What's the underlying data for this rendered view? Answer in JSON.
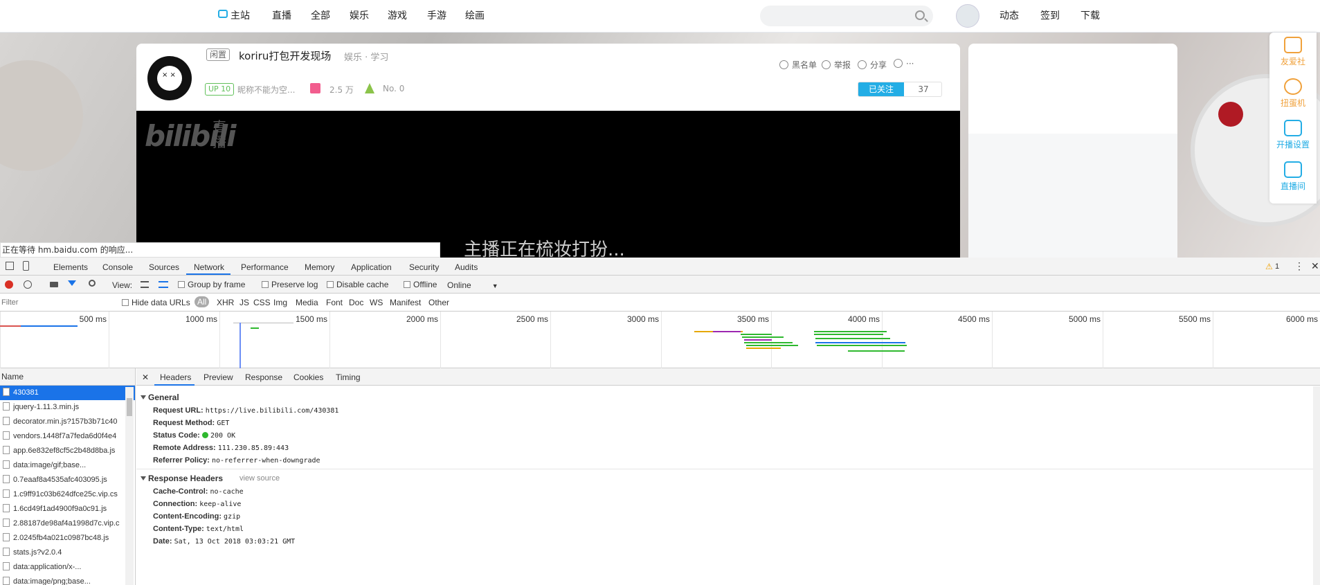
{
  "site_nav": {
    "links": [
      "主站",
      "直播",
      "全部",
      "娱乐",
      "游戏",
      "手游",
      "绘画"
    ],
    "right_links": [
      "动态",
      "签到",
      "下载"
    ]
  },
  "room": {
    "tag_status": "闲置",
    "title": "koriru打包开发现场",
    "category": "娱乐 · 学习",
    "up_level": "UP 10",
    "streamer": "昵称不能为空...",
    "gift_count": "2.5 万",
    "rank": "No. 0",
    "actions": [
      "黑名单",
      "举报",
      "分享",
      "···"
    ],
    "follow_label": "已关注",
    "follow_count": "37",
    "logo_text": "bilibili",
    "logo_sub": "直播",
    "video_message": "主播正在梳妆打扮..."
  },
  "right_bar": [
    "友爱社",
    "扭蛋机",
    "开播设置",
    "直播间"
  ],
  "status_text": "正在等待 hm.baidu.com 的响应...",
  "devtools": {
    "tabs": [
      "Elements",
      "Console",
      "Sources",
      "Network",
      "Performance",
      "Memory",
      "Application",
      "Security",
      "Audits"
    ],
    "active_tab": "Network",
    "warning_count": "1",
    "toolbar": {
      "view_label": "View:",
      "group_by_frame": "Group by frame",
      "preserve_log": "Preserve log",
      "disable_cache": "Disable cache",
      "offline": "Offline",
      "throttle": "Online"
    },
    "filter": {
      "placeholder": "Filter",
      "hide_data_urls": "Hide data URLs",
      "types": [
        "All",
        "XHR",
        "JS",
        "CSS",
        "Img",
        "Media",
        "Font",
        "Doc",
        "WS",
        "Manifest",
        "Other"
      ]
    },
    "timeline_ticks": [
      "500 ms",
      "1000 ms",
      "1500 ms",
      "2000 ms",
      "2500 ms",
      "3000 ms",
      "3500 ms",
      "4000 ms",
      "4500 ms",
      "5000 ms",
      "5500 ms",
      "6000 ms"
    ],
    "name_header": "Name",
    "requests": [
      "430381",
      "jquery-1.11.3.min.js",
      "decorator.min.js?157b3b71c40",
      "vendors.1448f7a7feda6d0f4e4",
      "app.6e832ef8cf5c2b48d8ba.js",
      "data:image/gif;base...",
      "0.7eaaf8a4535afc403095.js",
      "1.c9ff91c03b624dfce25c.vip.cs",
      "1.6cd49f1ad4900f9a0c91.js",
      "2.88187de98af4a1998d7c.vip.c",
      "2.0245fb4a021c0987bc48.js",
      "stats.js?v2.0.4",
      "data:application/x-...",
      "data:image/png;base..."
    ],
    "detail_tabs": [
      "Headers",
      "Preview",
      "Response",
      "Cookies",
      "Timing"
    ],
    "general": {
      "title": "General",
      "rows": [
        {
          "k": "Request URL:",
          "v": "https://live.bilibili.com/430381"
        },
        {
          "k": "Request Method:",
          "v": "GET"
        },
        {
          "k": "Status Code:",
          "v": "200 OK"
        },
        {
          "k": "Remote Address:",
          "v": "111.230.85.89:443"
        },
        {
          "k": "Referrer Policy:",
          "v": "no-referrer-when-downgrade"
        }
      ]
    },
    "response_headers": {
      "title": "Response Headers",
      "view_source": "view source",
      "rows": [
        {
          "k": "Cache-Control:",
          "v": "no-cache"
        },
        {
          "k": "Connection:",
          "v": "keep-alive"
        },
        {
          "k": "Content-Encoding:",
          "v": "gzip"
        },
        {
          "k": "Content-Type:",
          "v": "text/html"
        },
        {
          "k": "Date:",
          "v": "Sat, 13 Oct 2018 03:03:21 GMT"
        }
      ]
    }
  }
}
